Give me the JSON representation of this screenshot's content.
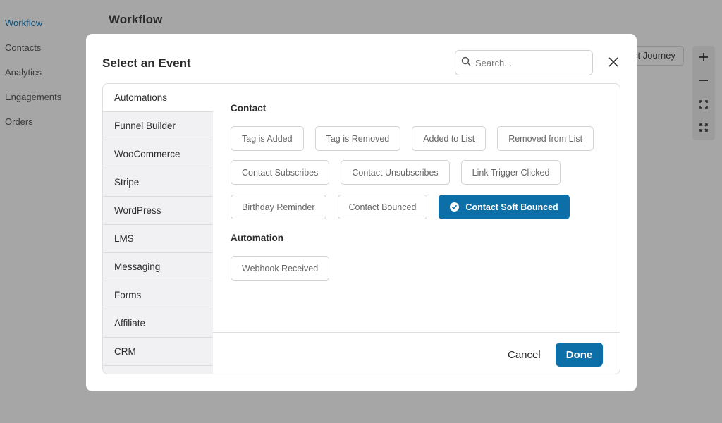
{
  "background": {
    "nav": [
      "Workflow",
      "Contacts",
      "Analytics",
      "Engagements",
      "Orders"
    ],
    "page_title": "Workflow",
    "journey_button": "ct Journey"
  },
  "modal": {
    "title": "Select an Event",
    "search_placeholder": "Search...",
    "categories": [
      "Automations",
      "Funnel Builder",
      "WooCommerce",
      "Stripe",
      "WordPress",
      "LMS",
      "Messaging",
      "Forms",
      "Affiliate",
      "CRM"
    ],
    "active_category": "Automations",
    "groups": [
      {
        "title": "Contact",
        "events": [
          "Tag is Added",
          "Tag is Removed",
          "Added to List",
          "Removed from List",
          "Contact Subscribes",
          "Contact Unsubscribes",
          "Link Trigger Clicked",
          "Birthday Reminder",
          "Contact Bounced",
          "Contact Soft Bounced"
        ]
      },
      {
        "title": "Automation",
        "events": [
          "Webhook Received"
        ]
      }
    ],
    "selected_event": "Contact Soft Bounced",
    "cancel_label": "Cancel",
    "done_label": "Done"
  },
  "colors": {
    "accent": "#0d6fa8",
    "overlay": "#a6a6a6"
  }
}
